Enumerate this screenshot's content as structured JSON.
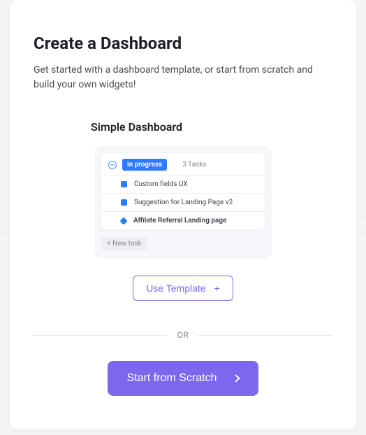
{
  "title": "Create a Dashboard",
  "subtitle": "Get started with a dashboard template, or start from scratch and build your own widgets!",
  "template": {
    "name": "Simple Dashboard",
    "preview": {
      "status_label": "in progress",
      "tasks_count": "3 Tasks",
      "tasks": [
        {
          "label": "Custom fields UX",
          "icon": "square",
          "bold": false
        },
        {
          "label": "Suggestion for Landing Page v2",
          "icon": "square",
          "bold": false
        },
        {
          "label": "Affilate Referral Landing page",
          "icon": "diamond",
          "bold": true
        }
      ],
      "new_task_label": "+ New task"
    },
    "use_button": "Use Template"
  },
  "divider": "OR",
  "scratch_button": "Start from Scratch"
}
